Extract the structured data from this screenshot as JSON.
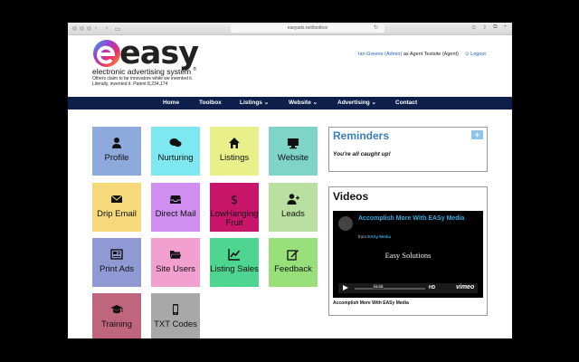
{
  "browser": {
    "url": "easyads.net/toolbox"
  },
  "header": {
    "logo_text": "easy",
    "tagline": "electronic advertising system",
    "trademark": "®",
    "small_line1": "Others claim to be innovators while we invented it.",
    "small_line2": "Literally, invented it. Patent 8,234,174",
    "user_name": "Ian Greene (Admin)",
    "user_suffix": "as Agent Testsite (Agent)",
    "logout_label": "Logout"
  },
  "nav": [
    {
      "label": "Home"
    },
    {
      "label": "Toolbox"
    },
    {
      "label": "Listings ⌄"
    },
    {
      "label": "Website ⌄"
    },
    {
      "label": "Advertising ⌄"
    },
    {
      "label": "Contact"
    }
  ],
  "tiles": [
    {
      "label": "Profile",
      "icon": "user-icon",
      "color": "#8ea9db"
    },
    {
      "label": "Nurturing",
      "icon": "chat-icon",
      "color": "#7ee8f0"
    },
    {
      "label": "Listings",
      "icon": "home-icon",
      "color": "#e9f08a"
    },
    {
      "label": "Website",
      "icon": "monitor-icon",
      "color": "#7fd4c8"
    },
    {
      "label": "Drip Email",
      "icon": "envelope-icon",
      "color": "#f5d97a"
    },
    {
      "label": "Direct Mail",
      "icon": "inbox-icon",
      "color": "#cf8ef0"
    },
    {
      "label": "LowHanging Fruit",
      "icon": "dollar-icon",
      "color": "#c8166b"
    },
    {
      "label": "Leads",
      "icon": "user-plus-icon",
      "color": "#b9e0a0"
    },
    {
      "label": "Print Ads",
      "icon": "newspaper-icon",
      "color": "#8f9ad4"
    },
    {
      "label": "Site Users",
      "icon": "folder-icon",
      "color": "#f2a0cf"
    },
    {
      "label": "Listing Sales",
      "icon": "chart-line-icon",
      "color": "#4ed590"
    },
    {
      "label": "Feedback",
      "icon": "edit-icon",
      "color": "#98e07a"
    },
    {
      "label": "Training",
      "icon": "graduation-cap-icon",
      "color": "#c0657e"
    },
    {
      "label": "TXT Codes",
      "icon": "phone-icon",
      "color": "#a8a8a8"
    }
  ],
  "reminders": {
    "title": "Reminders",
    "add_label": "+",
    "empty_text": "You're all caught up!"
  },
  "videos": {
    "title": "Videos",
    "video_title": "Accomplish More With EASy Media",
    "from_prefix": "from",
    "from_name": "EASy Media",
    "center_text": "Easy Solutions",
    "time": "04:28",
    "hd_label": "HD",
    "brand": "vimeo",
    "caption": "Accomplish More With EASy Media"
  }
}
